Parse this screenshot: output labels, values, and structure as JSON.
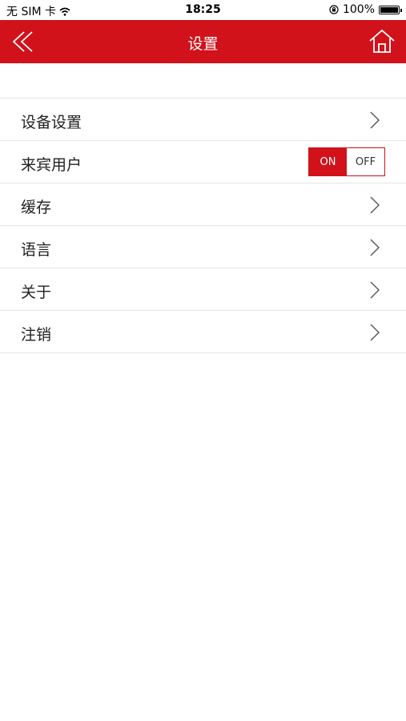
{
  "status_bar": {
    "carrier": "无 SIM 卡",
    "time": "18:25",
    "battery": "100%",
    "battery_level": 1.0
  },
  "nav": {
    "title": "设置",
    "back_icon": "double-chevron-left-icon",
    "home_icon": "home-icon"
  },
  "colors": {
    "brand": "#d1121b",
    "divider": "#e6e6e6"
  },
  "settings": {
    "items": [
      {
        "label": "设备设置",
        "type": "link"
      },
      {
        "label": "来宾用户",
        "type": "toggle",
        "on_label": "ON",
        "off_label": "OFF",
        "state": "on"
      },
      {
        "label": "缓存",
        "type": "link"
      },
      {
        "label": "语言",
        "type": "link"
      },
      {
        "label": "关于",
        "type": "link"
      },
      {
        "label": "注销",
        "type": "link"
      }
    ]
  }
}
